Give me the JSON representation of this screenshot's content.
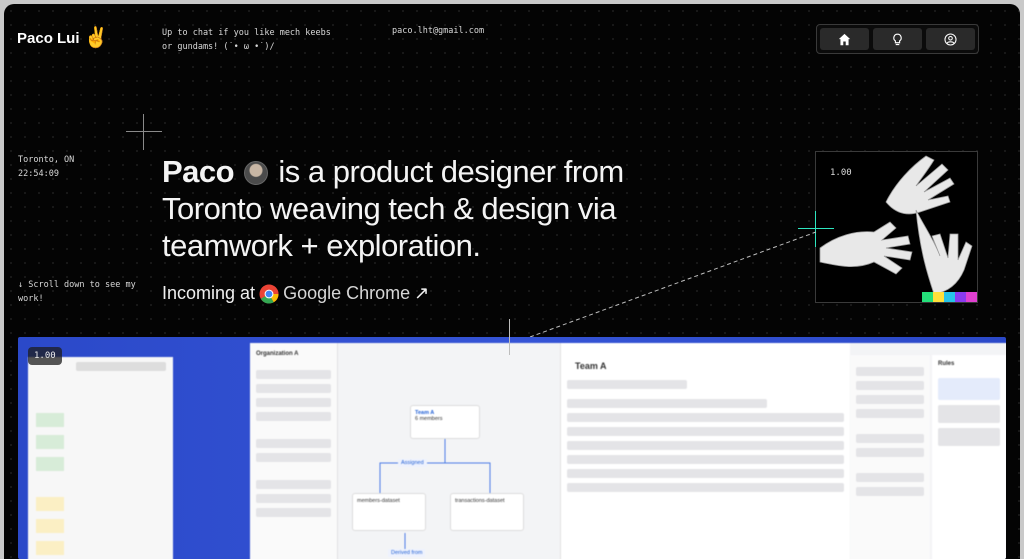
{
  "header": {
    "logo_text": "Paco Lui",
    "logo_emoji": "✌",
    "tagline": "Up to chat if you like mech keebs or gundams! (˙• ω •˙)/",
    "email": "paco.lht@gmail.com",
    "nav": [
      {
        "icon": "home-icon"
      },
      {
        "icon": "lightbulb-icon"
      },
      {
        "icon": "user-icon"
      }
    ]
  },
  "sidebar": {
    "city": "Toronto, ON",
    "time": "22:54:09",
    "scroll_hint": "↓ Scroll down to see my work!"
  },
  "hero": {
    "brand": "Paco",
    "headline_rest": " is a product designer from Toronto weaving tech & design via teamwork + exploration.",
    "incoming_prefix": "Incoming at",
    "incoming_company": "Google Chrome",
    "arrow": "↗"
  },
  "art_card": {
    "zoom": "1.00"
  },
  "showcase": {
    "zoom": "1.00",
    "org_name": "Organization A",
    "team_name": "Team A",
    "node_title": "Team A",
    "node_members": "6 members",
    "edge_label_1": "Assigned",
    "edge_label_2": "Derived from",
    "dataset_1": "members-dataset",
    "dataset_2": "transactions-dataset",
    "rules_title": "Rules"
  },
  "colors": {
    "background": "#040404",
    "accent": "#2ee6a6",
    "showcase_blue": "#3554d6",
    "swatches": [
      "#24e07a",
      "#ffe03a",
      "#26c4e8",
      "#8a3bf0",
      "#e040d0"
    ]
  }
}
